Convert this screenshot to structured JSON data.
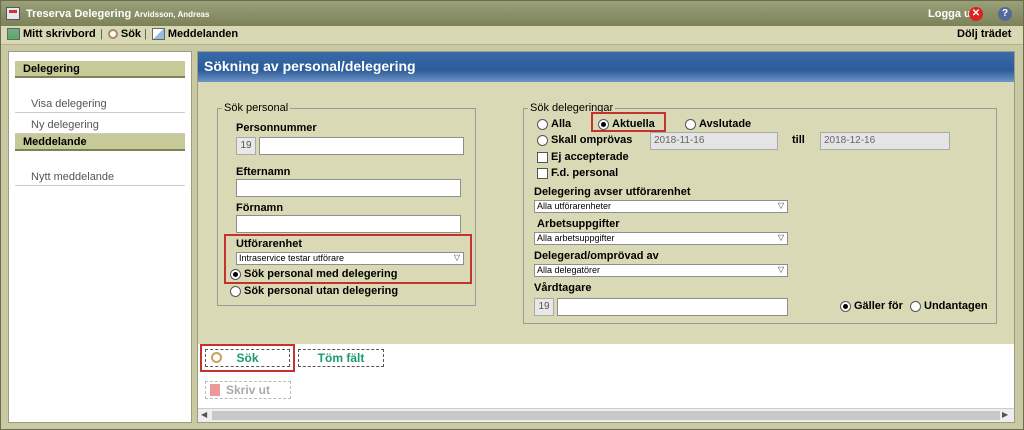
{
  "titlebar": {
    "app_title": "Treserva Delegering",
    "user_name": "Arvidsson, Andreas",
    "logout_label": "Logga ut"
  },
  "toolbar": {
    "mitt_skrivbord": "Mitt skrivbord",
    "sok": "Sök",
    "meddelanden": "Meddelanden",
    "dolj_tradet": "Dölj trädet"
  },
  "sidebar": {
    "delegering_head": "Delegering",
    "visa_delegering": "Visa delegering",
    "ny_delegering": "Ny delegering",
    "meddelande_head": "Meddelande",
    "nytt_meddelande": "Nytt meddelande"
  },
  "page": {
    "title": "Sökning av personal/delegering"
  },
  "sok_personal": {
    "legend": "Sök personal",
    "personnummer_label": "Personnummer",
    "personnummer_prefix": "19",
    "personnummer_value": "",
    "efternamn_label": "Efternamn",
    "efternamn_value": "",
    "fornamn_label": "Förnamn",
    "fornamn_value": "",
    "utforarenhet_label": "Utförarenhet",
    "utforarenhet_value": "Intraservice testar utförare",
    "med_delegering": "Sök personal med delegering",
    "utan_delegering": "Sök personal utan delegering",
    "selected": "med_delegering"
  },
  "sok_delegeringar": {
    "legend": "Sök delegeringar",
    "alla": "Alla",
    "aktuella": "Aktuella",
    "avslutade": "Avslutade",
    "skall_omprovas": "Skall omprövas",
    "date_from": "2018-11-16",
    "till": "till",
    "date_to": "2018-12-16",
    "ej_accepterade": "Ej accepterade",
    "fd_personal": "F.d. personal",
    "selected": "aktuella",
    "utforarenhet_label": "Delegering avser utförarenhet",
    "utforarenhet_value": "Alla utförarenheter",
    "arbetsuppgifter_label": "Arbetsuppgifter",
    "arbetsuppgifter_value": "Alla arbetsuppgifter",
    "delegerad_label": "Delegerad/omprövad av",
    "delegerad_value": "Alla delegatörer",
    "vardtagare_label": "Vårdtagare",
    "vardtagare_prefix": "19",
    "vardtagare_value": "",
    "galler_for": "Gäller för",
    "undantagen": "Undantagen",
    "scope_selected": "galler_for"
  },
  "buttons": {
    "sok": "Sök",
    "tom_falt": "Töm fält",
    "skriv_ut": "Skriv ut"
  },
  "colors": {
    "header_blue": "#2c5b9a",
    "form_bg": "#d9d9b6",
    "highlight_red": "#c4322d",
    "button_green": "#1a9a6a"
  }
}
